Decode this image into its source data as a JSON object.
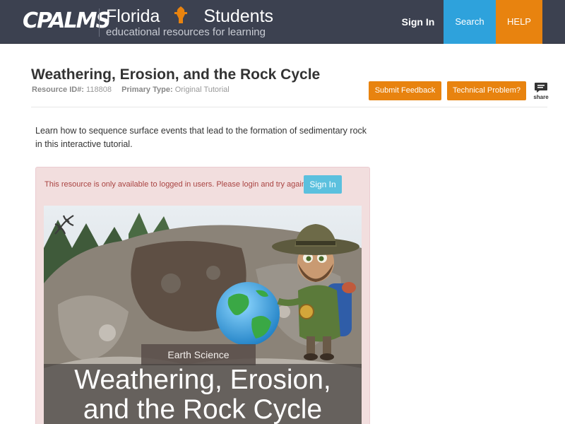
{
  "header": {
    "logo_text": "CPALMS",
    "brand_title_left": "Florida",
    "brand_title_right": "Students",
    "brand_subtitle": "educational resources for learning",
    "nav": {
      "signin": "Sign In",
      "search": "Search",
      "help": "HELP"
    }
  },
  "colors": {
    "header_bg": "#3c4150",
    "search_bg": "#2ea2dc",
    "orange": "#e8830f",
    "alert_bg": "#f2dede",
    "alert_text": "#a94442",
    "info_button": "#5bc0de"
  },
  "resource": {
    "title": "Weathering, Erosion, and the Rock Cycle",
    "id_label": "Resource ID#:",
    "id_value": "118808",
    "type_label": "Primary Type:",
    "type_value": "Original Tutorial",
    "buttons": {
      "feedback": "Submit Feedback",
      "technical": "Technical Problem?",
      "share": "share"
    },
    "description": "Learn how to sequence surface events that lead to the formation of sedimentary rock in this interactive tutorial."
  },
  "alert": {
    "message": "This resource is only available to logged in users. Please login and try again.",
    "signin": "Sign In"
  },
  "hero": {
    "tag": "Earth Science",
    "title_line1": "Weathering, Erosion,",
    "title_line2": "and the Rock Cycle",
    "icons": [
      "dna-icon",
      "globe-illustration",
      "explorer-character"
    ]
  }
}
